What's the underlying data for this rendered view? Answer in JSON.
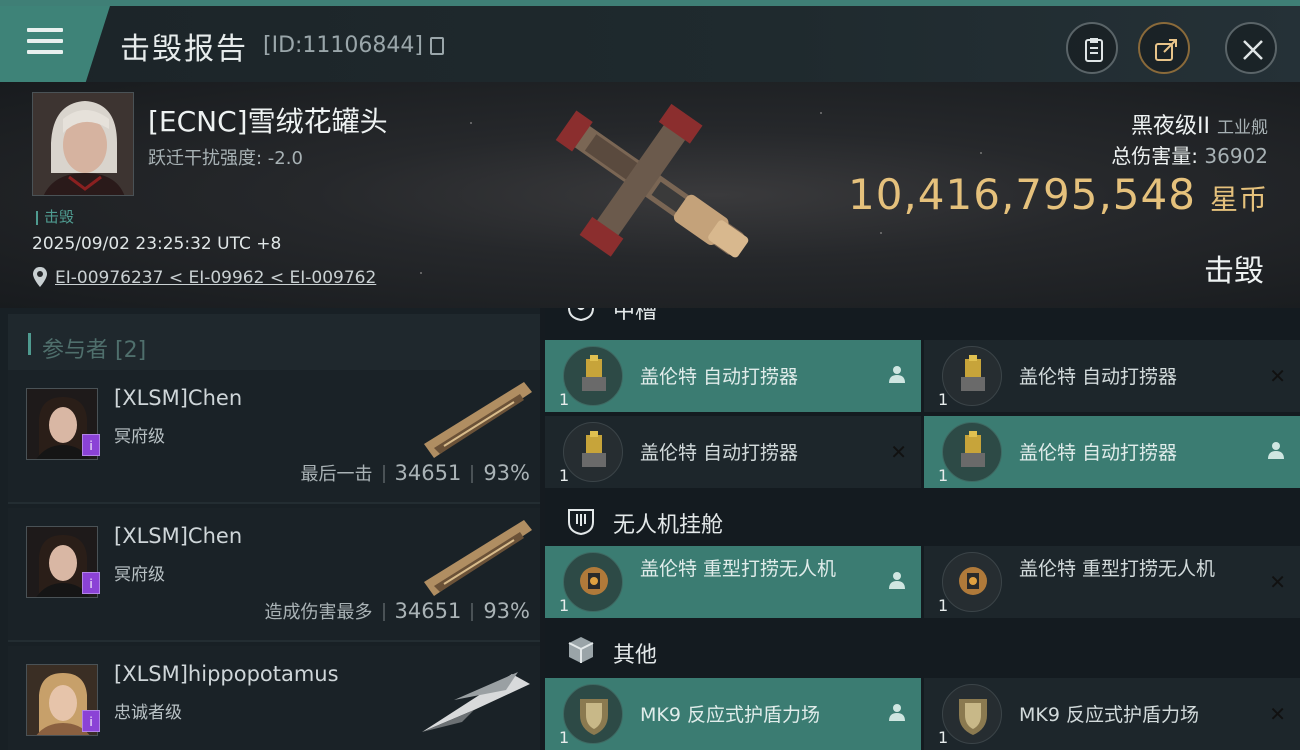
{
  "header": {
    "title": "击毁报告",
    "id_text": "[ID:11106844]"
  },
  "victim": {
    "name": "[ECNC]雪绒花罐头",
    "warp_disruption": "跃迁干扰强度: -2.0",
    "status_label": "击毁",
    "datetime": "2025/09/02 23:25:32 UTC +8",
    "location": "EI-00976237 < EI-09962 < EI-009762",
    "ship_class": "黑夜级II",
    "ship_type": "工业舰",
    "total_damage_label": "总伤害量:",
    "total_damage_value": "36902",
    "isk_value": "10,416,795,548",
    "isk_unit": "星币",
    "kill_status": "击毁"
  },
  "participants": {
    "header": "参与者 [2]",
    "rows": [
      {
        "name": "[XLSM]Chen",
        "ship": "冥府级",
        "label": "最后一击",
        "damage": "34651",
        "percent": "93%"
      },
      {
        "name": "[XLSM]Chen",
        "ship": "冥府级",
        "label": "造成伤害最多",
        "damage": "34651",
        "percent": "93%"
      },
      {
        "name": "[XLSM]hippopotamus",
        "ship": "忠诚者级",
        "label": "",
        "damage": "",
        "percent": ""
      }
    ]
  },
  "modules": {
    "section_mid": "中槽",
    "section_drone": "无人机挂舱",
    "section_other": "其他",
    "items": [
      {
        "label": "盖伦特 自动打捞器",
        "qty": "1",
        "state": "on"
      },
      {
        "label": "盖伦特 自动打捞器",
        "qty": "1",
        "state": "off"
      },
      {
        "label": "盖伦特 自动打捞器",
        "qty": "1",
        "state": "off"
      },
      {
        "label": "盖伦特 自动打捞器",
        "qty": "1",
        "state": "on"
      },
      {
        "label": "盖伦特 重型打捞无人机",
        "qty": "1",
        "state": "on"
      },
      {
        "label": "盖伦特 重型打捞无人机",
        "qty": "1",
        "state": "off"
      },
      {
        "label": "MK9 反应式护盾力场",
        "qty": "1",
        "state": "on"
      },
      {
        "label": "MK9 反应式护盾力场",
        "qty": "1",
        "state": "off"
      }
    ]
  },
  "colors": {
    "accent": "#3e8378",
    "isk": "#e5c17c",
    "badge": "#8b42d6"
  }
}
